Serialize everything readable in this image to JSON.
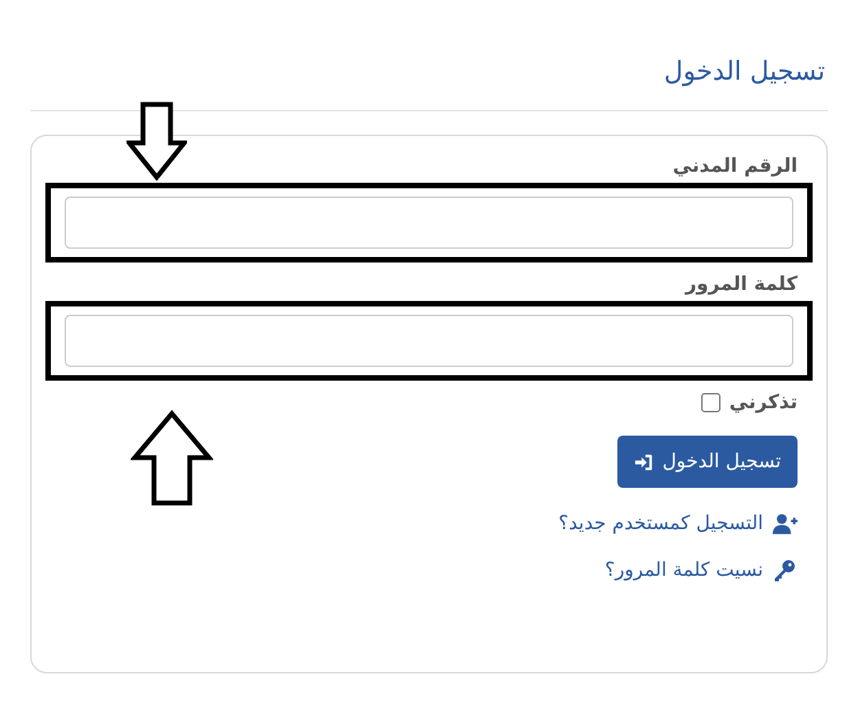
{
  "title": "تسجيل الدخول",
  "fields": [
    {
      "label": "الرقم المدني",
      "highlighted": true
    },
    {
      "label": "كلمة المرور",
      "highlighted": true
    }
  ],
  "remember": {
    "label": "تذكرني",
    "checked": false
  },
  "submit": {
    "label": "تسجيل الدخول"
  },
  "links": [
    {
      "kind": "register",
      "label": "التسجيل كمستخدم جديد؟"
    },
    {
      "kind": "forgot",
      "label": "نسيت كلمة المرور؟"
    }
  ]
}
